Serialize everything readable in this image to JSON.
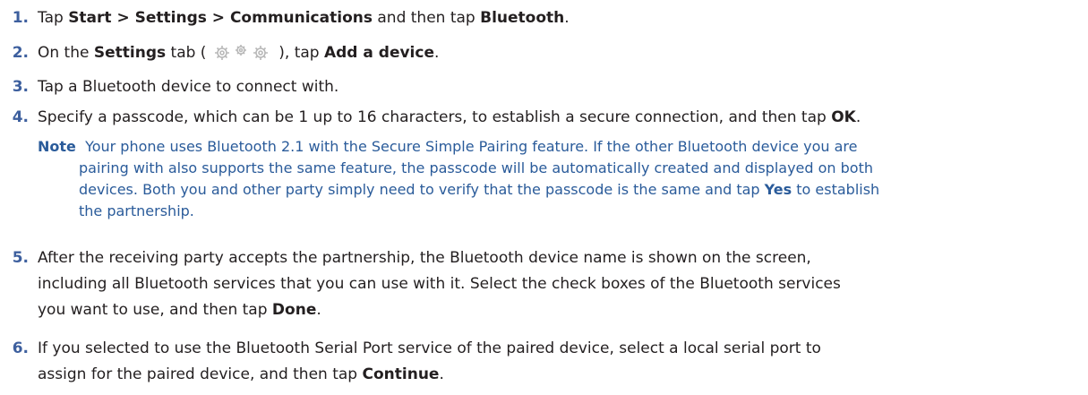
{
  "steps": [
    {
      "number": "1.",
      "parts": [
        "Tap ",
        "Start > Settings > Communications",
        " and then tap ",
        "Bluetooth",
        "."
      ]
    },
    {
      "number": "2.",
      "parts": [
        "On the ",
        "Settings",
        " tab ( ",
        " ), tap ",
        "Add a device",
        "."
      ]
    },
    {
      "number": "3.",
      "parts": [
        "Tap a Bluetooth device to connect with."
      ]
    },
    {
      "number": "4.",
      "parts": [
        "Specify a passcode, which can be 1 up to 16 characters, to establish a secure connection, and then tap ",
        "OK",
        "."
      ]
    },
    {
      "number": "5.",
      "lines": [
        "After the receiving party accepts the partnership, the Bluetooth device name is shown on the screen,",
        "including all Bluetooth services that you can use with it. Select the check boxes of the Bluetooth services"
      ],
      "last_line_parts": [
        "you want to use, and then tap ",
        "Done",
        "."
      ]
    },
    {
      "number": "6.",
      "lines": [
        "If you selected to use the Bluetooth Serial Port service of the paired device, select a local serial port to"
      ],
      "last_line_parts": [
        "assign for the paired device, and then tap ",
        "Continue",
        "."
      ]
    }
  ],
  "note": {
    "label": "Note",
    "line1": "Your phone uses Bluetooth 2.1 with the Secure Simple Pairing feature. If the other Bluetooth device you are",
    "line2": "pairing with also supports the same feature, the passcode will be automatically created and displayed on both",
    "line3_before": "devices. Both you and other party simply need to verify that the passcode is the same and tap ",
    "line3_bold": "Yes",
    "line3_after": " to establish",
    "line4": "the partnership."
  },
  "colors": {
    "accent": "#3d5f9e",
    "note": "#2a5b9a",
    "text": "#231f20"
  },
  "icons": [
    "settings-gears-icon"
  ]
}
